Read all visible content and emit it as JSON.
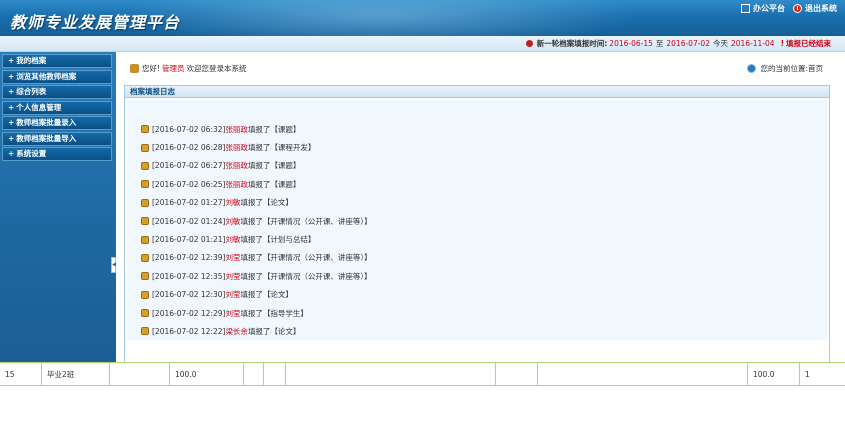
{
  "header": {
    "title": "教师专业发展管理平台",
    "office_label": "办公平台",
    "logout_label": "退出系统"
  },
  "infobar": {
    "label": "新一轮档案填报时间:",
    "start": "2016-06-15",
    "to": "至",
    "end": "2016-07-02",
    "today_label": "今天",
    "today": "2016-11-04",
    "status": "填报已经结束"
  },
  "sidebar": {
    "items": [
      {
        "label": "我的档案"
      },
      {
        "label": "浏览其他教师档案"
      },
      {
        "label": "综合列表"
      },
      {
        "label": "个人信息管理"
      },
      {
        "label": "教师档案批量录入"
      },
      {
        "label": "教师档案批量导入"
      },
      {
        "label": "系统设置"
      }
    ]
  },
  "main": {
    "greeting_prefix": "您好!",
    "user": "管理员",
    "greeting_suffix": "欢迎您登录本系统",
    "location_label": "您的当前位置:",
    "location": "首页",
    "panel_title": "档案填报日志",
    "logs": [
      {
        "time": "[2016-07-02 06:32]",
        "name": "张丽政",
        "action": "填报了",
        "item": "【课题】"
      },
      {
        "time": "[2016-07-02 06:28]",
        "name": "张丽政",
        "action": "填报了",
        "item": "【课程开发】"
      },
      {
        "time": "[2016-07-02 06:27]",
        "name": "张丽政",
        "action": "填报了",
        "item": "【课题】"
      },
      {
        "time": "[2016-07-02 06:25]",
        "name": "张丽政",
        "action": "填报了",
        "item": "【课题】"
      },
      {
        "time": "[2016-07-02 01:27]",
        "name": "刘敏",
        "action": "填报了",
        "item": "【论文】"
      },
      {
        "time": "[2016-07-02 01:24]",
        "name": "刘敏",
        "action": "填报了",
        "item": "【开课情况（公开课、讲座等）】"
      },
      {
        "time": "[2016-07-02 01:21]",
        "name": "刘敏",
        "action": "填报了",
        "item": "【计划与总结】"
      },
      {
        "time": "[2016-07-02 12:39]",
        "name": "刘莹",
        "action": "填报了",
        "item": "【开课情况（公开课、讲座等）】"
      },
      {
        "time": "[2016-07-02 12:35]",
        "name": "刘莹",
        "action": "填报了",
        "item": "【开课情况（公开课、讲座等）】"
      },
      {
        "time": "[2016-07-02 12:30]",
        "name": "刘莹",
        "action": "填报了",
        "item": "【论文】"
      },
      {
        "time": "[2016-07-02 12:29]",
        "name": "刘莹",
        "action": "填报了",
        "item": "【指导学生】"
      },
      {
        "time": "[2016-07-02 12:22]",
        "name": "梁长余",
        "action": "填报了",
        "item": "【论文】"
      }
    ]
  },
  "footer_row": {
    "cells": [
      "15",
      "毕业2班",
      "",
      "100.0",
      "",
      "",
      "",
      "",
      "",
      "100.0",
      "1"
    ]
  }
}
